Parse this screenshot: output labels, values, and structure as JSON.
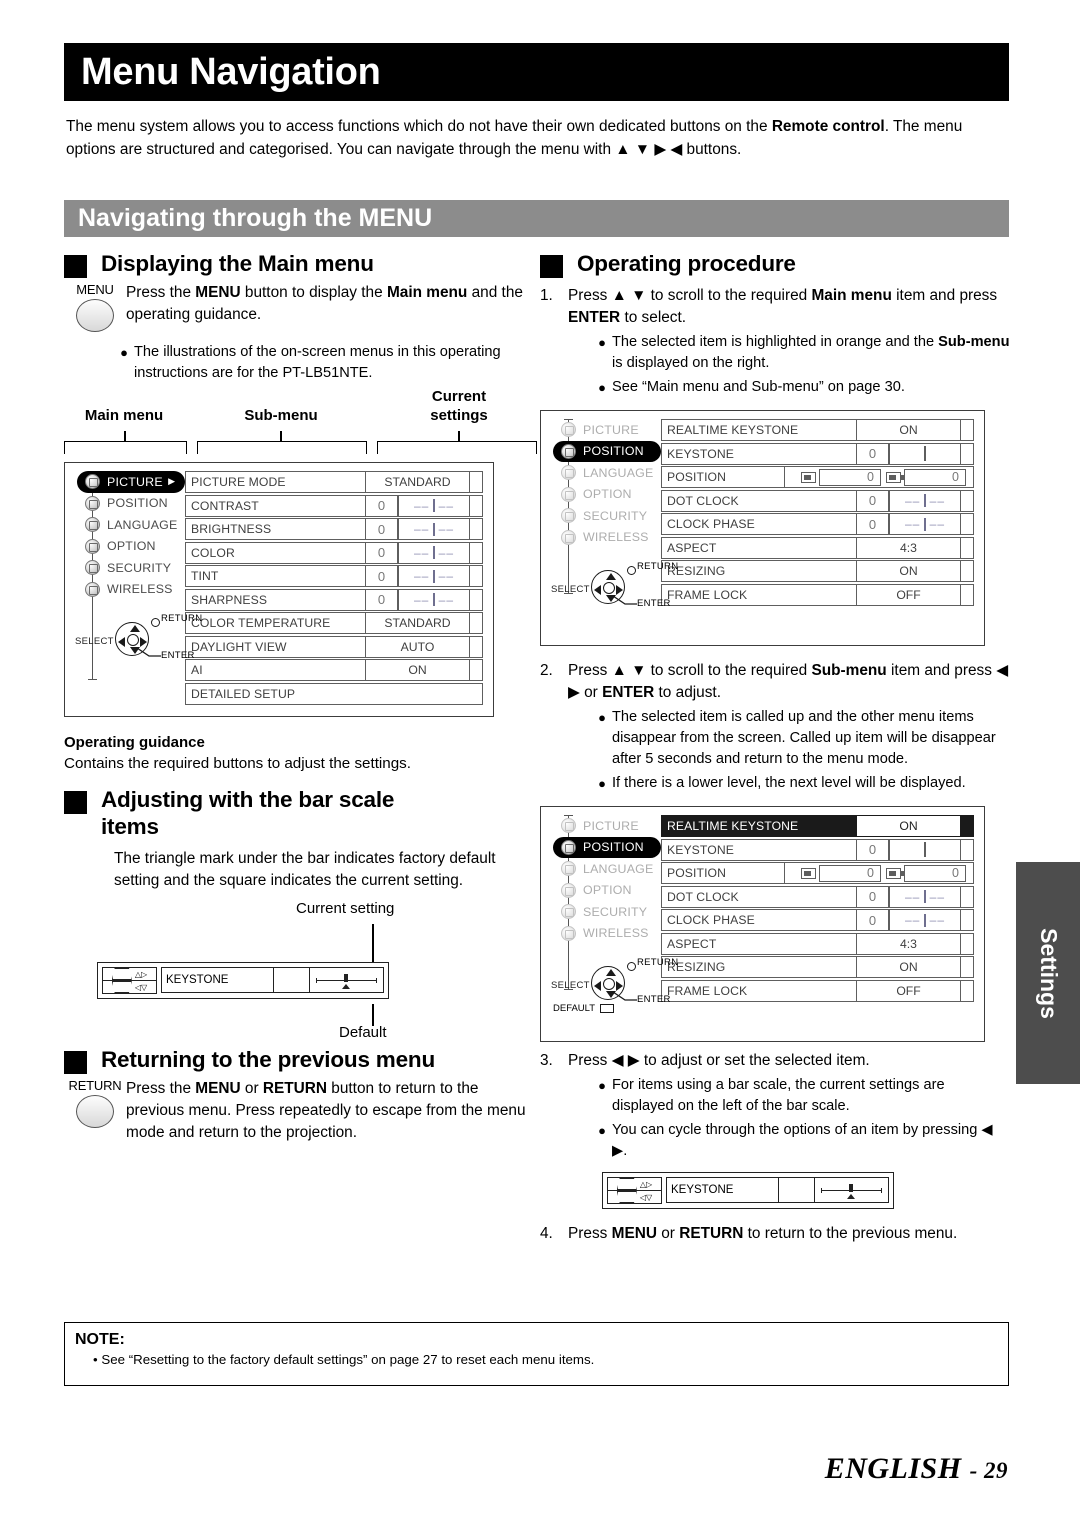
{
  "page": {
    "title": "Menu Navigation",
    "intro_html": "The menu system allows you to access functions which do not have their own dedicated buttons on the <b>Remote control</b>. The menu options are structured and categorised. You can navigate through the menu with ▲ ▼ ▶ ◀ buttons.",
    "section_banner": "Navigating through the MENU",
    "side_tab": "Settings",
    "footer_main": "ENGLISH",
    "footer_page": "- 29"
  },
  "note": {
    "title": "NOTE:",
    "items": [
      "•  See “Resetting to the factory default settings” on page 27 to reset each menu items."
    ]
  },
  "left": {
    "displaying": {
      "heading": "Displaying the Main menu",
      "button_label": "MENU",
      "body_html": "Press the <b>MENU</b> button to display the <b>Main menu</b> and the operating guidance.",
      "bullets": [
        "The illustrations of the on-screen menus in this operating instructions are for the PT-LB51NTE."
      ]
    },
    "diagram_labels": {
      "main_menu": "Main menu",
      "sub_menu": "Sub-menu",
      "current_settings": "Current\nsettings",
      "current_settings_l1": "Current",
      "current_settings_l2": "settings"
    },
    "operating_guidance": {
      "title": "Operating guidance",
      "text": "Contains the required buttons to adjust the settings."
    },
    "bar_scale": {
      "heading": "Adjusting with the bar scale items",
      "body": "The triangle mark under the bar indicates factory default setting and the square indicates the current setting.",
      "callout_top": "Current setting",
      "callout_bottom": "Default",
      "keystone_label": "KEYSTONE"
    },
    "returning": {
      "heading": "Returning to the previous menu",
      "button_label": "RETURN",
      "body_html": "Press the <b>MENU</b> or <b>RETURN</b> button to return to the previous menu. Press repeatedly to escape from the menu mode and return to the projection."
    }
  },
  "right": {
    "heading": "Operating procedure",
    "steps": [
      {
        "num": "1.",
        "text_html": "Press ▲ ▼ to scroll to the required <b>Main menu</b> item and press <b>ENTER</b> to select.",
        "bullets_html": [
          "The selected item is highlighted in orange and the <b>Sub-menu</b> is displayed on the right.",
          "See “Main menu and Sub-menu” on page 30."
        ]
      },
      {
        "num": "2.",
        "text_html": "Press ▲ ▼ to scroll to the required <b>Sub-menu</b> item and press ◀ ▶ or <b>ENTER</b> to adjust.",
        "bullets_html": [
          "The selected item is called up and the other menu items disappear from the screen. Called up item will be disappear after 5 seconds and return to the menu mode.",
          "If there is a lower level, the next level will be displayed."
        ]
      },
      {
        "num": "3.",
        "text_html": "Press ◀ ▶ to adjust or set the selected item.",
        "bullets_html": [
          "For items using a bar scale, the current settings are displayed on the left of the bar scale.",
          "You can cycle through the options of an item by pressing ◀ ▶."
        ]
      },
      {
        "num": "4.",
        "text_html": "Press <b>MENU</b> or <b>RETURN</b> to return to the previous menu.",
        "bullets_html": []
      }
    ],
    "keystone_label": "KEYSTONE"
  },
  "osd_common": {
    "main_items": [
      "PICTURE",
      "POSITION",
      "LANGUAGE",
      "OPTION",
      "SECURITY",
      "WIRELESS"
    ],
    "nav": {
      "select": "SELECT",
      "return": "RETURN",
      "enter": "ENTER",
      "default": "DEFAULT"
    }
  },
  "osd_picture": {
    "selected_main": "PICTURE",
    "rows": [
      {
        "label": "PICTURE MODE",
        "type": "text",
        "value": "STANDARD"
      },
      {
        "label": "CONTRAST",
        "type": "bar",
        "value": "0",
        "bar": "—— | ——"
      },
      {
        "label": "BRIGHTNESS",
        "type": "bar",
        "value": "0",
        "bar": "—— | ——"
      },
      {
        "label": "COLOR",
        "type": "bar",
        "value": "0",
        "bar": "—— | ——"
      },
      {
        "label": "TINT",
        "type": "bar",
        "value": "0",
        "bar": "—— | ——"
      },
      {
        "label": "SHARPNESS",
        "type": "bar",
        "value": "0",
        "bar": "—— | ——"
      },
      {
        "label": "COLOR TEMPERATURE",
        "type": "text",
        "value": "STANDARD"
      },
      {
        "label": "DAYLIGHT VIEW",
        "type": "text",
        "value": "AUTO"
      },
      {
        "label": "AI",
        "type": "text",
        "value": "ON"
      },
      {
        "label": "DETAILED SETUP",
        "type": "full",
        "value": ""
      }
    ]
  },
  "osd_position_a": {
    "selected_main": "POSITION",
    "rows": [
      {
        "label": "REALTIME KEYSTONE",
        "type": "text",
        "value": "ON"
      },
      {
        "label": "KEYSTONE",
        "type": "barempty",
        "value": "0",
        "bar": ""
      },
      {
        "label": "POSITION",
        "type": "position",
        "value_h": "0",
        "value_v": "0"
      },
      {
        "label": "DOT CLOCK",
        "type": "bar",
        "value": "0",
        "bar": "—— | ——"
      },
      {
        "label": "CLOCK PHASE",
        "type": "bar",
        "value": "0",
        "bar": "—— | ——"
      },
      {
        "label": "ASPECT",
        "type": "text",
        "value": "4:3"
      },
      {
        "label": "RESIZING",
        "type": "text",
        "value": "ON"
      },
      {
        "label": "FRAME LOCK",
        "type": "text",
        "value": "OFF"
      }
    ]
  },
  "osd_position_b": {
    "selected_main": "POSITION",
    "highlight_row": "REALTIME KEYSTONE",
    "rows": [
      {
        "label": "REALTIME KEYSTONE",
        "type": "text",
        "value": "ON",
        "highlight": true
      },
      {
        "label": "KEYSTONE",
        "type": "barempty",
        "value": "0",
        "bar": ""
      },
      {
        "label": "POSITION",
        "type": "position",
        "value_h": "0",
        "value_v": "0"
      },
      {
        "label": "DOT CLOCK",
        "type": "bar",
        "value": "0",
        "bar": "—— | ——"
      },
      {
        "label": "CLOCK PHASE",
        "type": "bar",
        "value": "0",
        "bar": "—— | ——"
      },
      {
        "label": "ASPECT",
        "type": "text",
        "value": "4:3"
      },
      {
        "label": "RESIZING",
        "type": "text",
        "value": "ON"
      },
      {
        "label": "FRAME LOCK",
        "type": "text",
        "value": "OFF"
      }
    ]
  }
}
